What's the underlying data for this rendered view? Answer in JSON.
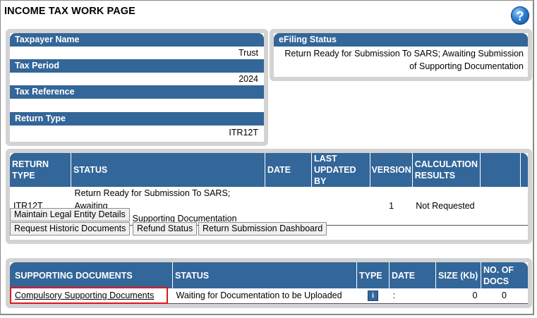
{
  "page_title": "INCOME TAX WORK PAGE",
  "help_icon": "?",
  "taxpayer": {
    "taxpayer_name_label": "Taxpayer Name",
    "taxpayer_name": "Trust",
    "tax_period_label": "Tax Period",
    "tax_period": "2024",
    "tax_reference_label": "Tax Reference",
    "tax_reference": "",
    "return_type_label": "Return Type",
    "return_type": "ITR12T"
  },
  "efiling": {
    "label": "eFiling Status",
    "status_line1": "Return Ready for Submission To SARS; Awaiting Submission",
    "status_line2": "of Supporting Documentation"
  },
  "returns_table": {
    "headers": {
      "return_type_1": "RETURN",
      "return_type_2": "TYPE",
      "status": "STATUS",
      "date": "DATE",
      "last_updated_1": "LAST",
      "last_updated_2": "UPDATED BY",
      "version": "VERSION",
      "calc_1": "CALCULATION",
      "calc_2": "RESULTS"
    },
    "row": {
      "return_type": "ITR12T",
      "status_line1": "Return Ready for Submission To SARS; Awaiting",
      "status_line2": "Submission of Supporting Documentation",
      "date": "",
      "last_updated_by": "",
      "version": "1",
      "calculation_results": "Not Requested"
    }
  },
  "buttons": {
    "maintain_legal_entity": "Maintain Legal Entity Details",
    "request_historic": "Request Historic Documents",
    "refund_status": "Refund Status",
    "return_submission_dashboard": "Return Submission Dashboard"
  },
  "supporting_table": {
    "headers": {
      "supporting_documents": "SUPPORTING DOCUMENTS",
      "status": "STATUS",
      "type": "TYPE",
      "date": "DATE",
      "size": "SIZE (Kb)",
      "num_docs_1": "NO. OF",
      "num_docs_2": "DOCS"
    },
    "row": {
      "name": "Compulsory Supporting Documents",
      "status": "Waiting for Documentation to be Uploaded",
      "type_icon": "i",
      "date": ":",
      "size": "0",
      "num_docs": "0"
    }
  },
  "colors": {
    "header_blue": "#336699",
    "panel_gray": "#d3d3d3",
    "highlight_red": "#e0161b"
  }
}
